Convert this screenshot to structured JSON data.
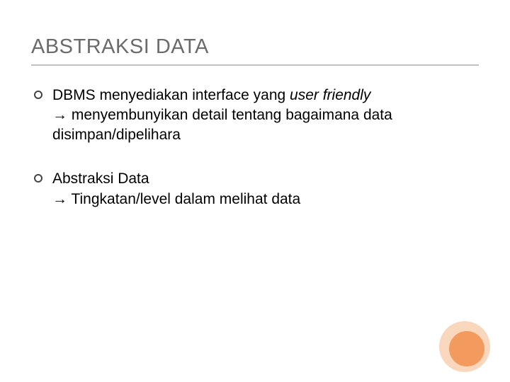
{
  "title": "ABSTRAKSI DATA",
  "bullets": [
    {
      "pre": "DBMS menyediakan interface yang ",
      "italic": "user friendly",
      "post1": " menyembunyikan detail tentang bagaimana data disimpan/dipelihara"
    },
    {
      "pre": "Abstraksi Data",
      "post1": " Tingkatan/level dalam melihat data"
    }
  ],
  "arrow_glyph": "→"
}
